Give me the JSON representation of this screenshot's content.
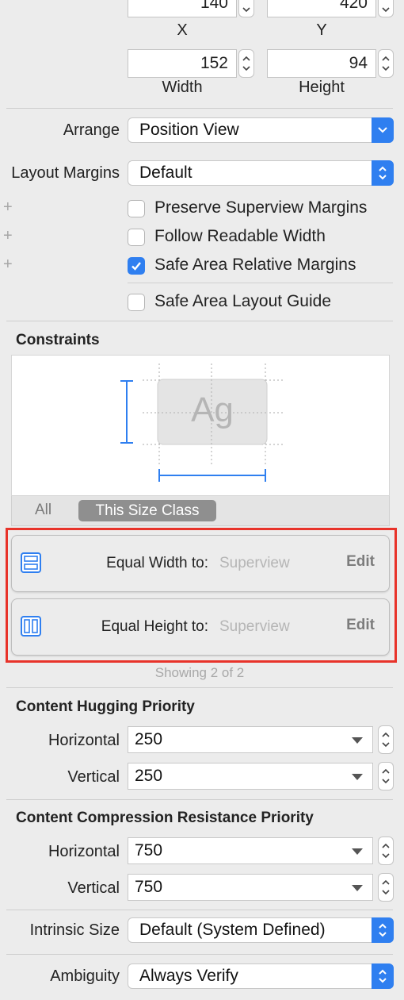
{
  "position": {
    "x_value": "140",
    "y_value": "420",
    "x_label": "X",
    "y_label": "Y",
    "width_value": "152",
    "height_value": "94",
    "width_label": "Width",
    "height_label": "Height"
  },
  "arrange": {
    "label": "Arrange",
    "value": "Position View"
  },
  "layout_margins": {
    "label": "Layout Margins",
    "value": "Default"
  },
  "checkboxes": [
    {
      "label": "Preserve Superview Margins",
      "checked": false
    },
    {
      "label": "Follow Readable Width",
      "checked": false
    },
    {
      "label": "Safe Area Relative Margins",
      "checked": true
    },
    {
      "label": "Safe Area Layout Guide",
      "checked": false
    }
  ],
  "constraints": {
    "title": "Constraints",
    "preview_text": "Ag",
    "tabs": {
      "all": "All",
      "size_class": "This Size Class"
    },
    "items": [
      {
        "label": "Equal Width to:",
        "target": "Superview",
        "edit": "Edit",
        "icon": "equal-width-icon"
      },
      {
        "label": "Equal Height to:",
        "target": "Superview",
        "edit": "Edit",
        "icon": "equal-height-icon"
      }
    ],
    "showing": "Showing 2 of 2"
  },
  "hugging": {
    "title": "Content Hugging Priority",
    "horizontal_label": "Horizontal",
    "horizontal_value": "250",
    "vertical_label": "Vertical",
    "vertical_value": "250"
  },
  "compression": {
    "title": "Content Compression Resistance Priority",
    "horizontal_label": "Horizontal",
    "horizontal_value": "750",
    "vertical_label": "Vertical",
    "vertical_value": "750"
  },
  "intrinsic_size": {
    "label": "Intrinsic Size",
    "value": "Default (System Defined)"
  },
  "ambiguity": {
    "label": "Ambiguity",
    "value": "Always Verify"
  },
  "colors": {
    "accent": "#2f7ff0",
    "highlight_box": "#e8332a"
  }
}
